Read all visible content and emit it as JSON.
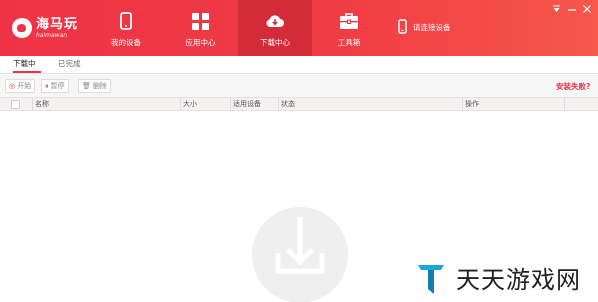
{
  "app": {
    "logo_cn": "海马玩",
    "logo_en": "haimawan"
  },
  "nav": [
    {
      "label": "我的设备",
      "icon": "phone-icon"
    },
    {
      "label": "应用中心",
      "icon": "grid-icon"
    },
    {
      "label": "下载中心",
      "icon": "cloud-download-icon",
      "active": true
    },
    {
      "label": "工具箱",
      "icon": "toolbox-icon"
    }
  ],
  "connect": {
    "label": "请连接设备",
    "icon": "device-icon"
  },
  "tabs": [
    {
      "label": "下载中",
      "active": true
    },
    {
      "label": "已完成",
      "active": false
    }
  ],
  "toolbar": {
    "start_label": "开始",
    "pause_label": "暂停",
    "delete_label": "删除",
    "fail_link": "安装失败?"
  },
  "table": {
    "headers": [
      "名称",
      "大小",
      "适用设备",
      "状态",
      "操作"
    ]
  },
  "watermark": {
    "text": "天天游戏网"
  },
  "colors": {
    "brand": "#ee3346",
    "active_nav": "#d42b39"
  }
}
